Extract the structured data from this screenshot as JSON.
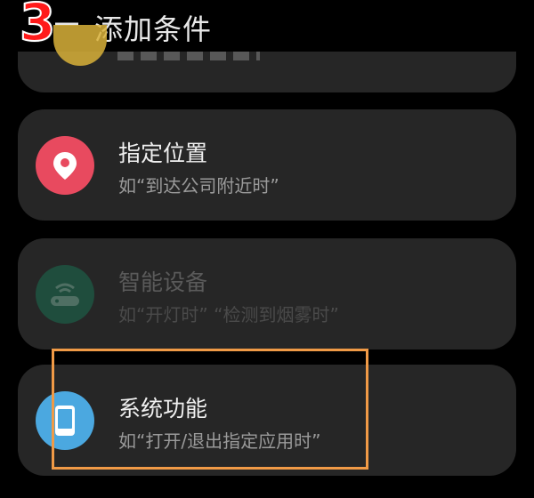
{
  "annotation": {
    "step_number": "3",
    "highlight_color": "#f09a46",
    "step_color": "#ff1a1a"
  },
  "header": {
    "title": "添加条件",
    "back_icon": "back-arrow-icon"
  },
  "conditions": [
    {
      "title": "指定位置",
      "description": "如“到达公司附近时”",
      "icon": "location-pin-icon",
      "icon_color": "#e84a5f",
      "enabled": true
    },
    {
      "title": "智能设备",
      "description": "如“开灯时” “检测到烟雾时”",
      "icon": "smart-device-icon",
      "icon_color": "#1f4d3d",
      "enabled": false
    },
    {
      "title": "系统功能",
      "description": "如“打开/退出指定应用时”",
      "icon": "phone-icon",
      "icon_color": "#4ba8e0",
      "enabled": true
    }
  ]
}
